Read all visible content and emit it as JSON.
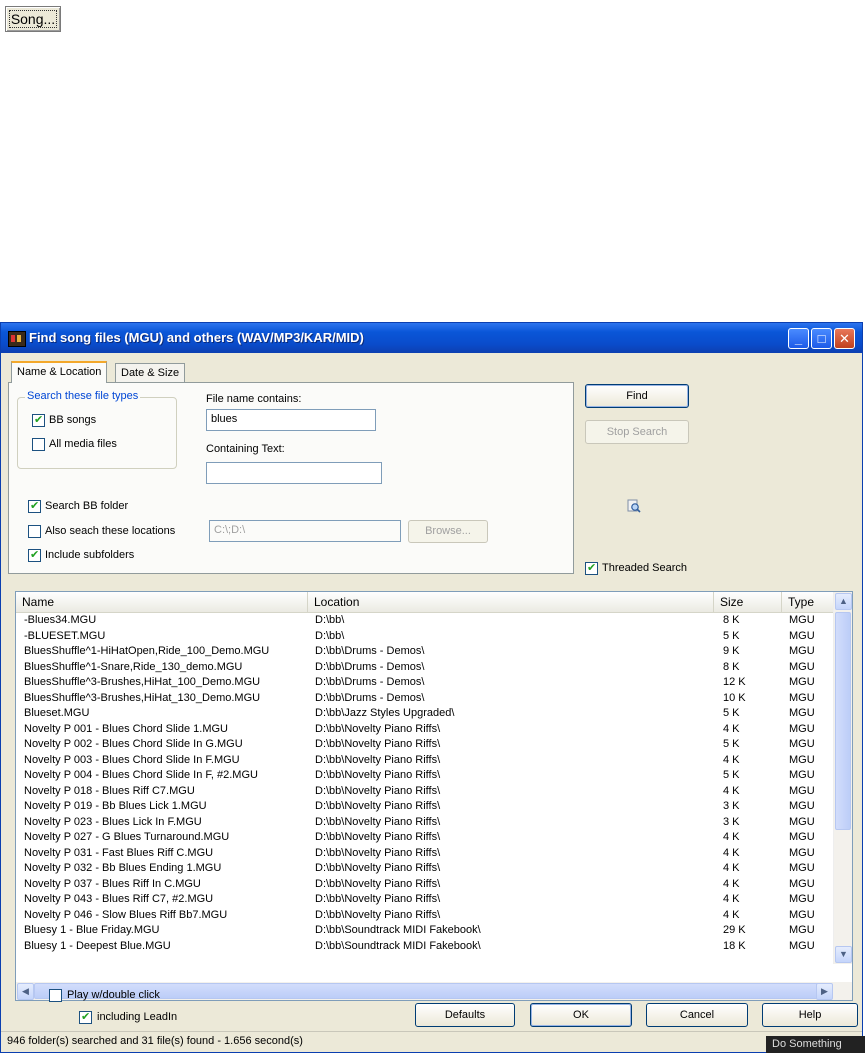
{
  "song_button": {
    "label": "Song..."
  },
  "window": {
    "title": "Find song files (MGU) and others (WAV/MP3/KAR/MID)",
    "controls": {
      "minimize": "_",
      "maximize": "□",
      "close": "✕"
    }
  },
  "tabs": [
    {
      "label": "Name & Location"
    },
    {
      "label": "Date & Size"
    }
  ],
  "file_types": {
    "legend": "Search these file types",
    "bb_songs": {
      "label": "BB songs",
      "checked": true
    },
    "all_media": {
      "label": "All media files",
      "checked": false
    }
  },
  "filename": {
    "label": "File name contains:",
    "value": "blues"
  },
  "containing_text": {
    "label": "Containing Text:",
    "value": ""
  },
  "search_bb_folder": {
    "label": "Search BB folder",
    "checked": true
  },
  "also_search": {
    "label": "Also seach these locations",
    "checked": false,
    "value": "C:\\;D:\\",
    "browse_label": "Browse..."
  },
  "include_subfolders": {
    "label": "Include subfolders",
    "checked": true
  },
  "find_button": "Find",
  "stop_button": "Stop Search",
  "threaded": {
    "label": "Threaded Search",
    "checked": true
  },
  "icons": {
    "magnify": "magnify-icon"
  },
  "columns": {
    "name": "Name",
    "location": "Location",
    "size": "Size",
    "type": "Type"
  },
  "rows": [
    {
      "name": "-Blues34.MGU",
      "location": "D:\\bb\\",
      "size": "8 K",
      "type": "MGU"
    },
    {
      "name": "-BLUESET.MGU",
      "location": "D:\\bb\\",
      "size": "5 K",
      "type": "MGU"
    },
    {
      "name": "BluesShuffle^1-HiHatOpen,Ride_100_Demo.MGU",
      "location": "D:\\bb\\Drums - Demos\\",
      "size": "9 K",
      "type": "MGU"
    },
    {
      "name": "BluesShuffle^1-Snare,Ride_130_demo.MGU",
      "location": "D:\\bb\\Drums - Demos\\",
      "size": "8 K",
      "type": "MGU"
    },
    {
      "name": "BluesShuffle^3-Brushes,HiHat_100_Demo.MGU",
      "location": "D:\\bb\\Drums - Demos\\",
      "size": "12 K",
      "type": "MGU"
    },
    {
      "name": "BluesShuffle^3-Brushes,HiHat_130_Demo.MGU",
      "location": "D:\\bb\\Drums - Demos\\",
      "size": "10 K",
      "type": "MGU"
    },
    {
      "name": "Blueset.MGU",
      "location": "D:\\bb\\Jazz Styles Upgraded\\",
      "size": "5 K",
      "type": "MGU"
    },
    {
      "name": "Novelty P 001 - Blues Chord Slide 1.MGU",
      "location": "D:\\bb\\Novelty Piano Riffs\\",
      "size": "4 K",
      "type": "MGU"
    },
    {
      "name": "Novelty P 002 - Blues Chord Slide In G.MGU",
      "location": "D:\\bb\\Novelty Piano Riffs\\",
      "size": "5 K",
      "type": "MGU"
    },
    {
      "name": "Novelty P 003 - Blues Chord Slide In F.MGU",
      "location": "D:\\bb\\Novelty Piano Riffs\\",
      "size": "4 K",
      "type": "MGU"
    },
    {
      "name": "Novelty P 004 - Blues Chord Slide In F, #2.MGU",
      "location": "D:\\bb\\Novelty Piano Riffs\\",
      "size": "5 K",
      "type": "MGU"
    },
    {
      "name": "Novelty P 018 - Blues Riff C7.MGU",
      "location": "D:\\bb\\Novelty Piano Riffs\\",
      "size": "4 K",
      "type": "MGU"
    },
    {
      "name": "Novelty P 019 - Bb Blues Lick 1.MGU",
      "location": "D:\\bb\\Novelty Piano Riffs\\",
      "size": "3 K",
      "type": "MGU"
    },
    {
      "name": "Novelty P 023 - Blues Lick In F.MGU",
      "location": "D:\\bb\\Novelty Piano Riffs\\",
      "size": "3 K",
      "type": "MGU"
    },
    {
      "name": "Novelty P 027 - G Blues Turnaround.MGU",
      "location": "D:\\bb\\Novelty Piano Riffs\\",
      "size": "4 K",
      "type": "MGU"
    },
    {
      "name": "Novelty P 031 - Fast Blues Riff C.MGU",
      "location": "D:\\bb\\Novelty Piano Riffs\\",
      "size": "4 K",
      "type": "MGU"
    },
    {
      "name": "Novelty P 032 - Bb Blues Ending 1.MGU",
      "location": "D:\\bb\\Novelty Piano Riffs\\",
      "size": "4 K",
      "type": "MGU"
    },
    {
      "name": "Novelty P 037 - Blues Riff In C.MGU",
      "location": "D:\\bb\\Novelty Piano Riffs\\",
      "size": "4 K",
      "type": "MGU"
    },
    {
      "name": "Novelty P 043 - Blues Riff C7, #2.MGU",
      "location": "D:\\bb\\Novelty Piano Riffs\\",
      "size": "4 K",
      "type": "MGU"
    },
    {
      "name": "Novelty P 046 - Slow Blues Riff Bb7.MGU",
      "location": "D:\\bb\\Novelty Piano Riffs\\",
      "size": "4 K",
      "type": "MGU"
    },
    {
      "name": "Bluesy 1 - Blue Friday.MGU",
      "location": "D:\\bb\\Soundtrack MIDI Fakebook\\",
      "size": "29 K",
      "type": "MGU"
    },
    {
      "name": "Bluesy 1 - Deepest Blue.MGU",
      "location": "D:\\bb\\Soundtrack MIDI Fakebook\\",
      "size": "18 K",
      "type": "MGU"
    }
  ],
  "play_double_click": {
    "label": "Play w/double click",
    "checked": false
  },
  "including_leadin": {
    "label": "including LeadIn",
    "checked": true
  },
  "buttons": {
    "defaults": "Defaults",
    "ok": "OK",
    "cancel": "Cancel",
    "help": "Help"
  },
  "status": "946 folder(s) searched and 31 file(s) found - 1.656 second(s)",
  "tooltip_tag": "Do Something"
}
